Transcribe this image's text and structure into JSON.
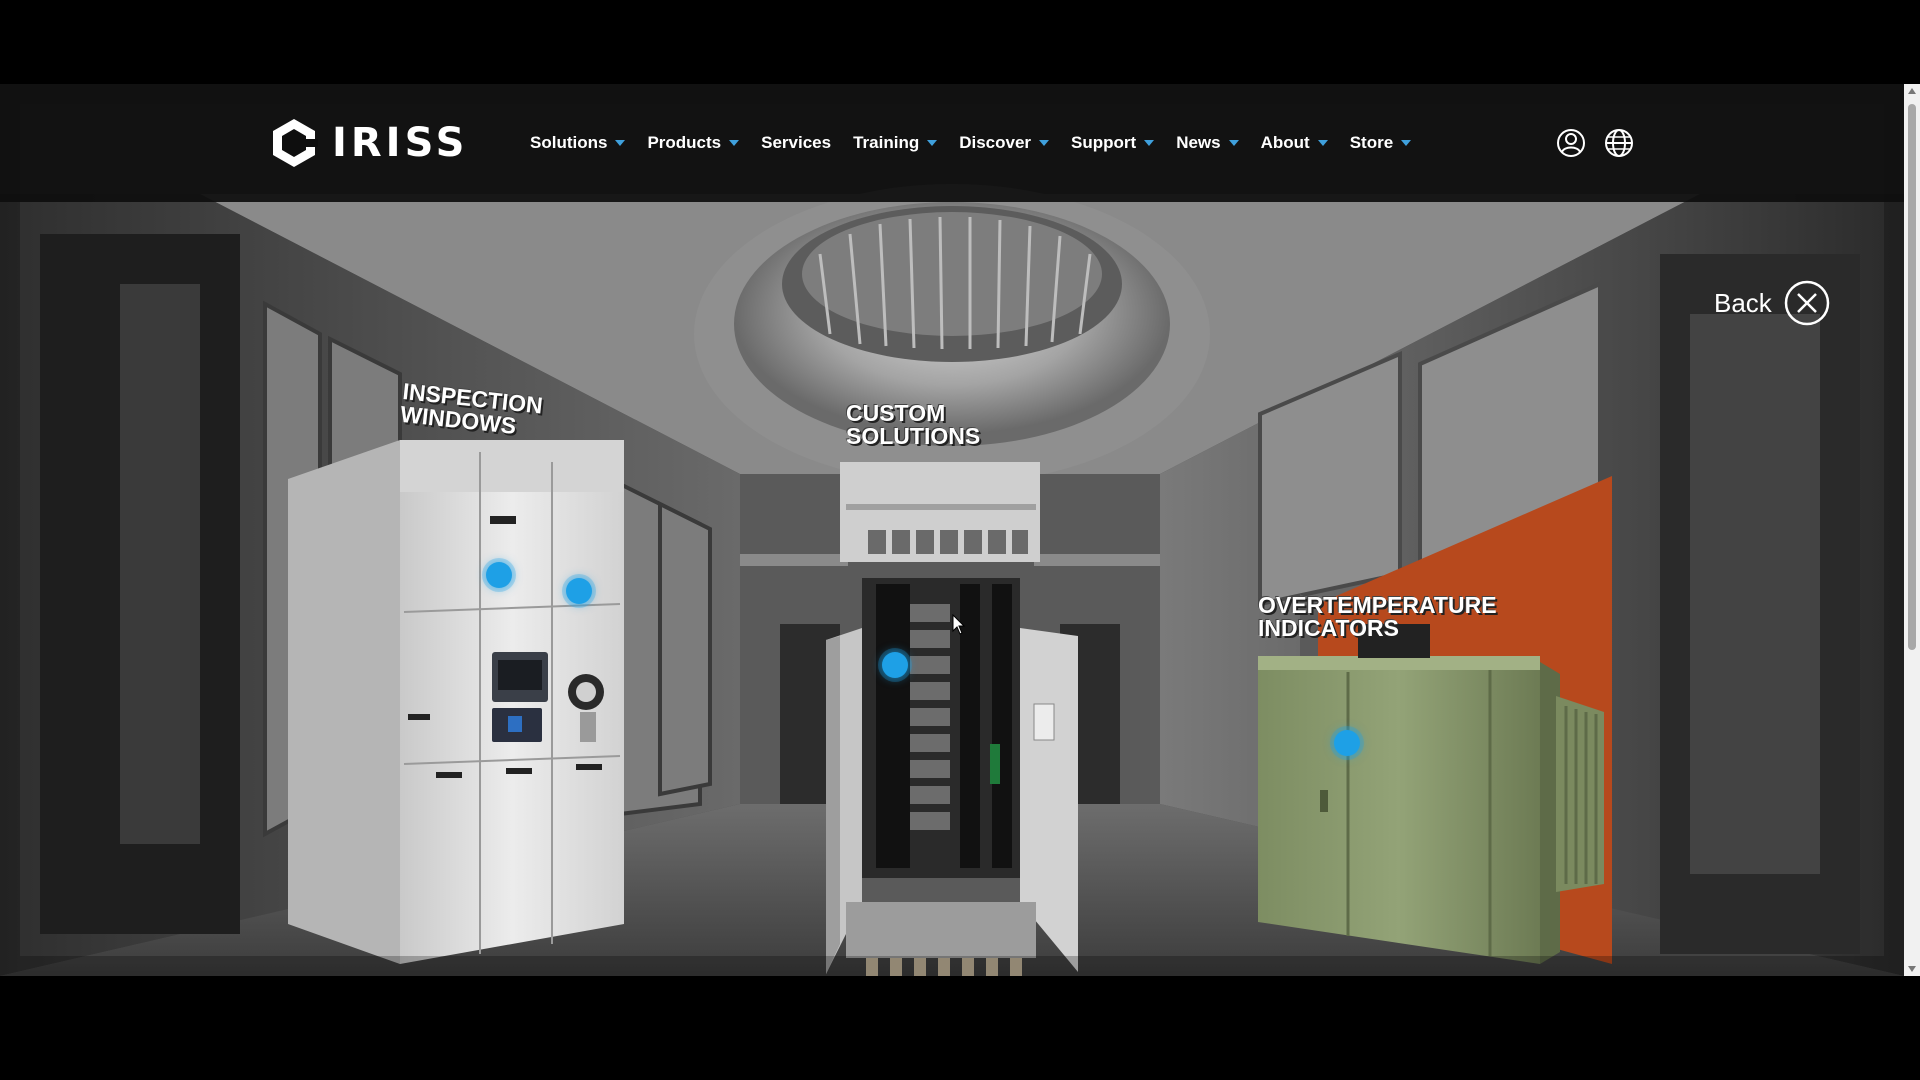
{
  "site": {
    "logo_text": "IRISS"
  },
  "nav": {
    "items": [
      {
        "label": "Solutions",
        "has_dropdown": true
      },
      {
        "label": "Products",
        "has_dropdown": true
      },
      {
        "label": "Services",
        "has_dropdown": false
      },
      {
        "label": "Training",
        "has_dropdown": true
      },
      {
        "label": "Discover",
        "has_dropdown": true
      },
      {
        "label": "Support",
        "has_dropdown": true
      },
      {
        "label": "News",
        "has_dropdown": true
      },
      {
        "label": "About",
        "has_dropdown": true
      },
      {
        "label": "Store",
        "has_dropdown": true
      }
    ]
  },
  "header_icons": [
    "user-account-icon",
    "globe-language-icon"
  ],
  "back": {
    "label": "Back",
    "icon": "close-circle-icon"
  },
  "products": {
    "inspection": {
      "line1": "INSPECTION",
      "line2": "WINDOWS"
    },
    "custom": {
      "line1": "CUSTOM",
      "line2": "SOLUTIONS"
    },
    "overtemp": {
      "line1": "OVERTEMPERATURE",
      "line2": "INDICATORS"
    }
  },
  "colors": {
    "accent": "#3fa0dc",
    "hotspot": "#1ea0e6",
    "header_bg": "#0e0e0e"
  }
}
